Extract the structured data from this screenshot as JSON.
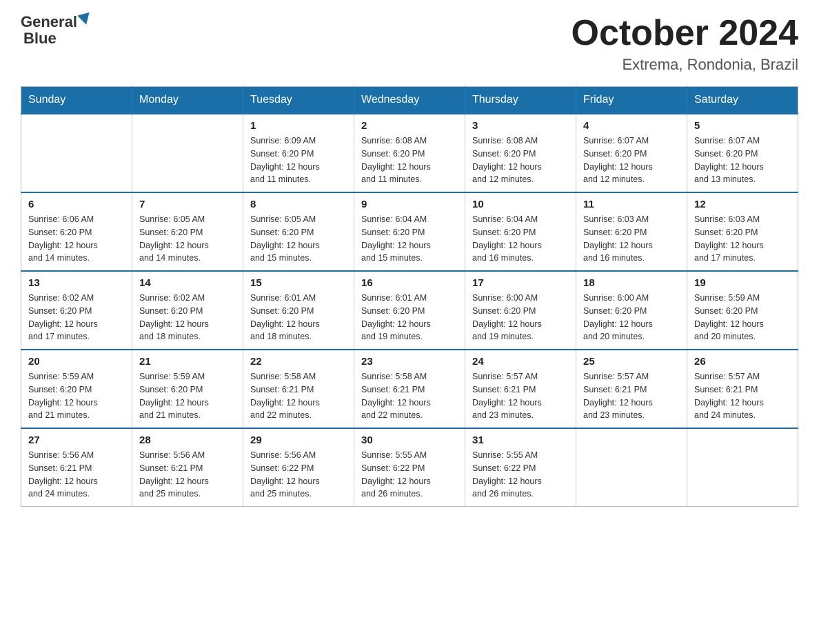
{
  "header": {
    "logo_general": "General",
    "logo_blue": "Blue",
    "month_title": "October 2024",
    "location": "Extrema, Rondonia, Brazil"
  },
  "weekdays": [
    "Sunday",
    "Monday",
    "Tuesday",
    "Wednesday",
    "Thursday",
    "Friday",
    "Saturday"
  ],
  "weeks": [
    [
      {
        "day": "",
        "info": ""
      },
      {
        "day": "",
        "info": ""
      },
      {
        "day": "1",
        "info": "Sunrise: 6:09 AM\nSunset: 6:20 PM\nDaylight: 12 hours\nand 11 minutes."
      },
      {
        "day": "2",
        "info": "Sunrise: 6:08 AM\nSunset: 6:20 PM\nDaylight: 12 hours\nand 11 minutes."
      },
      {
        "day": "3",
        "info": "Sunrise: 6:08 AM\nSunset: 6:20 PM\nDaylight: 12 hours\nand 12 minutes."
      },
      {
        "day": "4",
        "info": "Sunrise: 6:07 AM\nSunset: 6:20 PM\nDaylight: 12 hours\nand 12 minutes."
      },
      {
        "day": "5",
        "info": "Sunrise: 6:07 AM\nSunset: 6:20 PM\nDaylight: 12 hours\nand 13 minutes."
      }
    ],
    [
      {
        "day": "6",
        "info": "Sunrise: 6:06 AM\nSunset: 6:20 PM\nDaylight: 12 hours\nand 14 minutes."
      },
      {
        "day": "7",
        "info": "Sunrise: 6:05 AM\nSunset: 6:20 PM\nDaylight: 12 hours\nand 14 minutes."
      },
      {
        "day": "8",
        "info": "Sunrise: 6:05 AM\nSunset: 6:20 PM\nDaylight: 12 hours\nand 15 minutes."
      },
      {
        "day": "9",
        "info": "Sunrise: 6:04 AM\nSunset: 6:20 PM\nDaylight: 12 hours\nand 15 minutes."
      },
      {
        "day": "10",
        "info": "Sunrise: 6:04 AM\nSunset: 6:20 PM\nDaylight: 12 hours\nand 16 minutes."
      },
      {
        "day": "11",
        "info": "Sunrise: 6:03 AM\nSunset: 6:20 PM\nDaylight: 12 hours\nand 16 minutes."
      },
      {
        "day": "12",
        "info": "Sunrise: 6:03 AM\nSunset: 6:20 PM\nDaylight: 12 hours\nand 17 minutes."
      }
    ],
    [
      {
        "day": "13",
        "info": "Sunrise: 6:02 AM\nSunset: 6:20 PM\nDaylight: 12 hours\nand 17 minutes."
      },
      {
        "day": "14",
        "info": "Sunrise: 6:02 AM\nSunset: 6:20 PM\nDaylight: 12 hours\nand 18 minutes."
      },
      {
        "day": "15",
        "info": "Sunrise: 6:01 AM\nSunset: 6:20 PM\nDaylight: 12 hours\nand 18 minutes."
      },
      {
        "day": "16",
        "info": "Sunrise: 6:01 AM\nSunset: 6:20 PM\nDaylight: 12 hours\nand 19 minutes."
      },
      {
        "day": "17",
        "info": "Sunrise: 6:00 AM\nSunset: 6:20 PM\nDaylight: 12 hours\nand 19 minutes."
      },
      {
        "day": "18",
        "info": "Sunrise: 6:00 AM\nSunset: 6:20 PM\nDaylight: 12 hours\nand 20 minutes."
      },
      {
        "day": "19",
        "info": "Sunrise: 5:59 AM\nSunset: 6:20 PM\nDaylight: 12 hours\nand 20 minutes."
      }
    ],
    [
      {
        "day": "20",
        "info": "Sunrise: 5:59 AM\nSunset: 6:20 PM\nDaylight: 12 hours\nand 21 minutes."
      },
      {
        "day": "21",
        "info": "Sunrise: 5:59 AM\nSunset: 6:20 PM\nDaylight: 12 hours\nand 21 minutes."
      },
      {
        "day": "22",
        "info": "Sunrise: 5:58 AM\nSunset: 6:21 PM\nDaylight: 12 hours\nand 22 minutes."
      },
      {
        "day": "23",
        "info": "Sunrise: 5:58 AM\nSunset: 6:21 PM\nDaylight: 12 hours\nand 22 minutes."
      },
      {
        "day": "24",
        "info": "Sunrise: 5:57 AM\nSunset: 6:21 PM\nDaylight: 12 hours\nand 23 minutes."
      },
      {
        "day": "25",
        "info": "Sunrise: 5:57 AM\nSunset: 6:21 PM\nDaylight: 12 hours\nand 23 minutes."
      },
      {
        "day": "26",
        "info": "Sunrise: 5:57 AM\nSunset: 6:21 PM\nDaylight: 12 hours\nand 24 minutes."
      }
    ],
    [
      {
        "day": "27",
        "info": "Sunrise: 5:56 AM\nSunset: 6:21 PM\nDaylight: 12 hours\nand 24 minutes."
      },
      {
        "day": "28",
        "info": "Sunrise: 5:56 AM\nSunset: 6:21 PM\nDaylight: 12 hours\nand 25 minutes."
      },
      {
        "day": "29",
        "info": "Sunrise: 5:56 AM\nSunset: 6:22 PM\nDaylight: 12 hours\nand 25 minutes."
      },
      {
        "day": "30",
        "info": "Sunrise: 5:55 AM\nSunset: 6:22 PM\nDaylight: 12 hours\nand 26 minutes."
      },
      {
        "day": "31",
        "info": "Sunrise: 5:55 AM\nSunset: 6:22 PM\nDaylight: 12 hours\nand 26 minutes."
      },
      {
        "day": "",
        "info": ""
      },
      {
        "day": "",
        "info": ""
      }
    ]
  ]
}
